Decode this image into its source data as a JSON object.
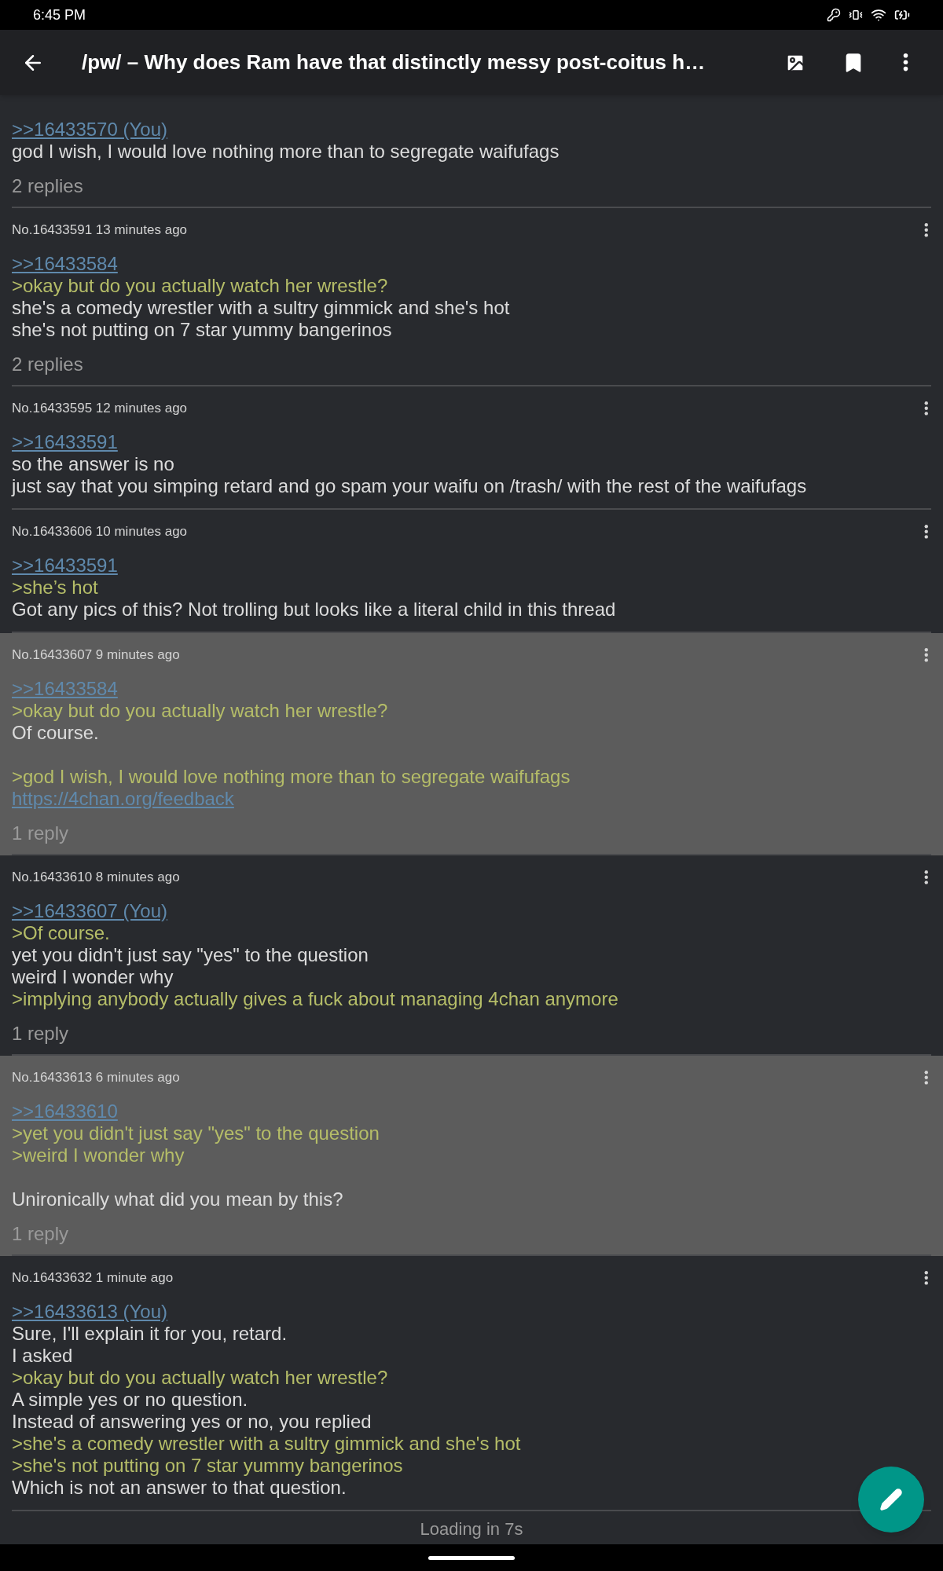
{
  "status_bar": {
    "time": "6:45 PM"
  },
  "toolbar": {
    "title": "/pw/ – Why does Ram have that distinctly messy post-coitus h…"
  },
  "posts": [
    {
      "highlighted": false,
      "lines": [
        {
          "kind": "link",
          "text": ">>16433570 (You)"
        },
        {
          "kind": "text",
          "text": "god I wish, I would love nothing more than to segregate waifufags"
        }
      ],
      "replies": "2 replies"
    },
    {
      "header": "No.16433591 13 minutes ago",
      "highlighted": false,
      "lines": [
        {
          "kind": "link",
          "text": ">>16433584"
        },
        {
          "kind": "quote",
          "text": ">okay but do you actually watch her wrestle?"
        },
        {
          "kind": "text",
          "text": "she's a comedy wrestler with a sultry gimmick and she's hot"
        },
        {
          "kind": "text",
          "text": "she's not putting on 7 star yummy bangerinos"
        }
      ],
      "replies": "2 replies"
    },
    {
      "header": "No.16433595 12 minutes ago",
      "highlighted": false,
      "lines": [
        {
          "kind": "link",
          "text": ">>16433591"
        },
        {
          "kind": "text",
          "text": "so the answer is no"
        },
        {
          "kind": "text",
          "text": "just say that you simping retard and go spam your waifu on /trash/ with the rest of the waifufags"
        }
      ]
    },
    {
      "header": "No.16433606 10 minutes ago",
      "highlighted": false,
      "lines": [
        {
          "kind": "link",
          "text": ">>16433591"
        },
        {
          "kind": "quote",
          "text": ">she’s hot"
        },
        {
          "kind": "text",
          "text": "Got any pics of this? Not trolling but looks like a literal child in this thread"
        }
      ]
    },
    {
      "header": "No.16433607 9 minutes ago",
      "highlighted": true,
      "lines": [
        {
          "kind": "link",
          "text": ">>16433584"
        },
        {
          "kind": "quote",
          "text": ">okay but do you actually watch her wrestle?"
        },
        {
          "kind": "text",
          "text": "Of course."
        },
        {
          "kind": "gap"
        },
        {
          "kind": "quote",
          "text": ">god I wish, I would love nothing more than to segregate waifufags"
        },
        {
          "kind": "link",
          "text": "https://4chan.org/feedback"
        }
      ],
      "replies": "1 reply"
    },
    {
      "header": "No.16433610 8 minutes ago",
      "highlighted": false,
      "lines": [
        {
          "kind": "link",
          "text": ">>16433607 (You)"
        },
        {
          "kind": "quote",
          "text": ">Of course."
        },
        {
          "kind": "text",
          "text": "yet you didn't just say \"yes\" to the question"
        },
        {
          "kind": "text",
          "text": "weird I wonder why"
        },
        {
          "kind": "quote",
          "text": ">implying anybody actually gives a fuck about managing 4chan anymore"
        }
      ],
      "replies": "1 reply"
    },
    {
      "header": "No.16433613 6 minutes ago",
      "highlighted": true,
      "lines": [
        {
          "kind": "link",
          "text": ">>16433610"
        },
        {
          "kind": "quote",
          "text": ">yet you didn't just say \"yes\" to the question"
        },
        {
          "kind": "quote",
          "text": ">weird I wonder why"
        },
        {
          "kind": "gap"
        },
        {
          "kind": "text",
          "text": "Unironically what did you mean by this?"
        }
      ],
      "replies": "1 reply"
    },
    {
      "header": "No.16433632 1 minute ago",
      "highlighted": false,
      "lines": [
        {
          "kind": "link",
          "text": ">>16433613 (You)"
        },
        {
          "kind": "text",
          "text": "Sure, I'll explain it for you, retard."
        },
        {
          "kind": "text",
          "text": "I asked"
        },
        {
          "kind": "quote",
          "text": ">okay but do you actually watch her wrestle?"
        },
        {
          "kind": "text",
          "text": "A simple yes or no question."
        },
        {
          "kind": "text",
          "text": "Instead of answering yes or no, you replied"
        },
        {
          "kind": "quote",
          "text": ">she's a comedy wrestler with a sultry gimmick and she's hot"
        },
        {
          "kind": "quote",
          "text": ">she's not putting on 7 star yummy bangerinos"
        },
        {
          "kind": "text",
          "text": "Which is not an answer to that question."
        }
      ]
    }
  ],
  "footer": {
    "status": "Loading in 7s"
  }
}
